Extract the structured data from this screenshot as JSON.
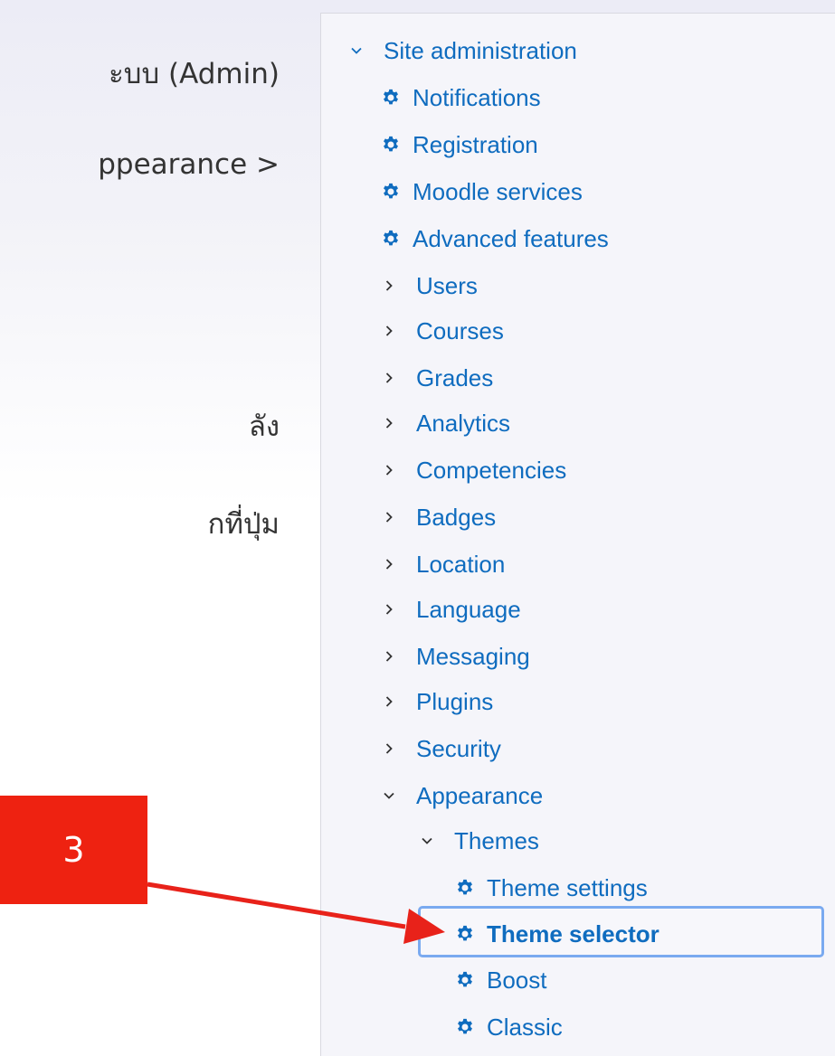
{
  "instructions": {
    "line1": "ะบบ (Admin)",
    "line2": "ppearance >",
    "line3": "ลัง",
    "line4": "กที่ปุ่ม"
  },
  "callout": {
    "label": "3",
    "color": "#ee2211"
  },
  "nav": {
    "link_color": "#0f6cbf",
    "items": [
      {
        "label": "Site administration",
        "icon": "chevron-down-icon"
      },
      {
        "label": "Notifications",
        "icon": "gear-icon"
      },
      {
        "label": "Registration",
        "icon": "gear-icon"
      },
      {
        "label": "Moodle services",
        "icon": "gear-icon"
      },
      {
        "label": "Advanced features",
        "icon": "gear-icon"
      },
      {
        "label": "Users",
        "icon": "chevron-right-icon"
      },
      {
        "label": "Courses",
        "icon": "chevron-right-icon"
      },
      {
        "label": "Grades",
        "icon": "chevron-right-icon"
      },
      {
        "label": "Analytics",
        "icon": "chevron-right-icon"
      },
      {
        "label": "Competencies",
        "icon": "chevron-right-icon"
      },
      {
        "label": "Badges",
        "icon": "chevron-right-icon"
      },
      {
        "label": "Location",
        "icon": "chevron-right-icon"
      },
      {
        "label": "Language",
        "icon": "chevron-right-icon"
      },
      {
        "label": "Messaging",
        "icon": "chevron-right-icon"
      },
      {
        "label": "Plugins",
        "icon": "chevron-right-icon"
      },
      {
        "label": "Security",
        "icon": "chevron-right-icon"
      },
      {
        "label": "Appearance",
        "icon": "chevron-down-icon"
      },
      {
        "label": "Themes",
        "icon": "chevron-down-icon"
      },
      {
        "label": "Theme settings",
        "icon": "gear-icon"
      },
      {
        "label": "Theme selector",
        "icon": "gear-icon",
        "selected": true
      },
      {
        "label": "Boost",
        "icon": "gear-icon"
      },
      {
        "label": "Classic",
        "icon": "gear-icon"
      }
    ]
  }
}
